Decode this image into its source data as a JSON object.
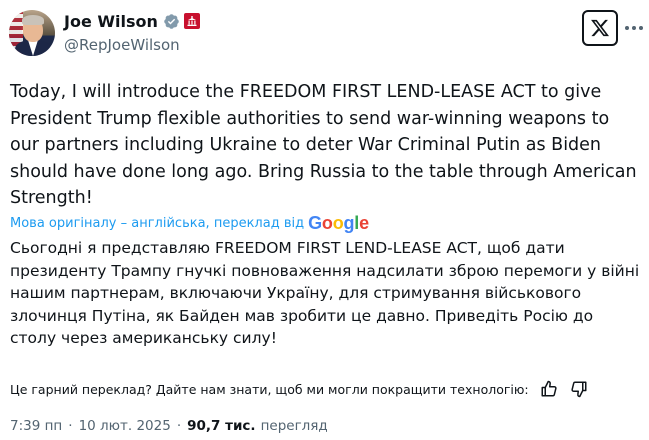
{
  "author": {
    "name": "Joe Wilson",
    "handle": "@RepJoeWilson"
  },
  "icons": {
    "verified": "verified-check-icon",
    "government": "government-affiliation-icon",
    "x_logo": "x-logo-icon",
    "more": "more-options-icon",
    "thumbs_up": "thumbs-up-icon",
    "thumbs_down": "thumbs-down-icon"
  },
  "colors": {
    "verified_badge": "#829aab",
    "link": "#1d9bf0",
    "gov_badge": "#c8102e",
    "muted_text": "#536471"
  },
  "tweet": {
    "text": "Today, I will introduce the FREEDOM FIRST LEND-LEASE ACT to give President Trump flexible authorities to send war-winning weapons to our partners including Ukraine to deter War Criminal Putin as Biden should have done long ago. Bring Russia to the table through American Strength!"
  },
  "translation": {
    "note": "Мова оригіналу – англійська, переклад від",
    "provider": "Google",
    "text": "Сьогодні я представляю FREEDOM FIRST LEND-LEASE ACT, щоб дати президенту Трампу гнучкі повноваження надсилати зброю перемоги у війні нашим партнерам, включаючи Україну, для стримування військового злочинця Путіна, як Байден мав зробити це давно. Приведіть Росію до столу через американську силу!",
    "feedback_question": "Це гарний переклад? Дайте нам знати, щоб ми могли покращити технологію:"
  },
  "meta": {
    "time": "7:39 пп",
    "date": "10 лют. 2025",
    "separator": "·",
    "views_count": "90,7 тис.",
    "views_label": "перегляд"
  }
}
